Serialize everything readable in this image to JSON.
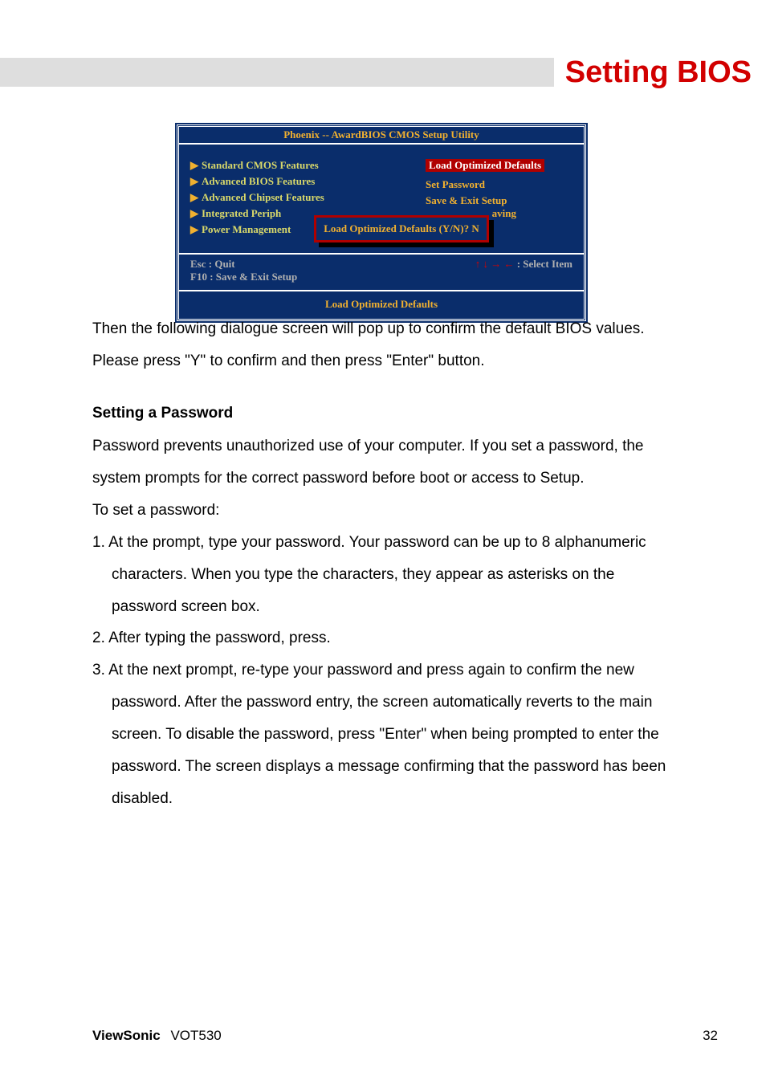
{
  "header": {
    "title": "Setting BIOS"
  },
  "bios": {
    "titlebar": "Phoenix  --  AwardBIOS CMOS Setup Utility",
    "left_items": [
      "Standard  CMOS Features",
      "Advanced  BIOS  Features",
      "Advanced  Chipset  Features",
      "Integrated  Periph",
      "Power  Management"
    ],
    "right_items": {
      "highlighted": "Load  Optimized  Defaults",
      "plain": [
        "Set  Password",
        "Save  &  Exit  Setup"
      ]
    },
    "popup": "Load  Optimized  Defaults  (Y/N)?  N",
    "popup_tail": "aving",
    "keyhelp": {
      "left1": "Esc  :  Quit",
      "left2": "F10  :  Save  &  Exit  Setup",
      "arrows": "↑ ↓ → ←",
      "right": "  :  Select  Item"
    },
    "footer": "Load Optimized  Defaults"
  },
  "body": {
    "p1a": "Then the following dialogue screen will pop up to confirm the default BIOS values.",
    "p1b": "Please press \"Y\" to confirm and then press \"Enter\" button.",
    "h1": "Setting a Password",
    "p2a": "Password prevents unauthorized use of your computer. If you set a password, the",
    "p2b": "system prompts for the correct password before boot or access to Setup.",
    "p2c": "To set a password:",
    "l1a": "1. At the prompt, type your password. Your password can be up to 8 alphanumeric",
    "l1b": "characters. When you type the characters, they appear as asterisks on the",
    "l1c": "password screen box.",
    "l2": "2. After typing the password, press.",
    "l3a": "3. At the next prompt, re-type your password and press again to confirm the new",
    "l3b": "password. After the password entry, the screen automatically reverts to the main",
    "l3c": "screen. To disable the password, press \"Enter\" when being prompted to enter the",
    "l3d": "password. The screen displays a message confirming that the password has been",
    "l3e": "disabled."
  },
  "footer": {
    "brand": "ViewSonic",
    "model": "VOT530",
    "page": "32"
  }
}
